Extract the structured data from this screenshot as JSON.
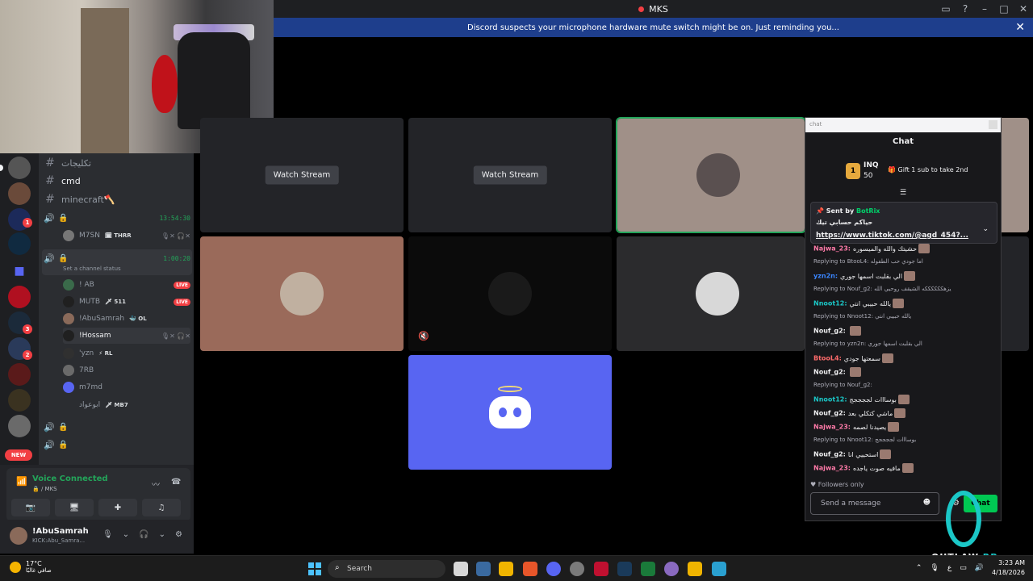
{
  "window": {
    "title": "MKS",
    "notice": "Discord suspects your microphone hardware mute switch might be on. Just reminding you..."
  },
  "rail": {
    "badges": [
      "1",
      "3",
      "2"
    ],
    "new_label": "NEW"
  },
  "channels": {
    "items": [
      {
        "name": "تكليجات"
      },
      {
        "name": "cmd"
      },
      {
        "name": "minecraft🪓"
      }
    ],
    "voice1": {
      "timer": "13:54:30"
    },
    "voice1_members": [
      {
        "name": "M7SN",
        "tag": "🗓 THRR"
      }
    ],
    "voice2": {
      "timer": "1:00:20",
      "status": "Set a channel status"
    },
    "voice2_members": [
      {
        "name": "! AB",
        "tag": "",
        "live": "LIVE"
      },
      {
        "name": "MUTB",
        "tag": "🗡 511",
        "live": "LIVE"
      },
      {
        "name": "!AbuSamrah",
        "tag": "🐳 OL",
        "live": ""
      },
      {
        "name": "!Hossam",
        "tag": "",
        "live": ""
      },
      {
        "name": "'yzn",
        "tag": "⚡ RL",
        "live": ""
      },
      {
        "name": "7RB",
        "tag": "",
        "live": ""
      },
      {
        "name": "m7md",
        "tag": "",
        "live": ""
      },
      {
        "name": "ابوعواد",
        "tag": "🗡 MB7",
        "live": ""
      }
    ]
  },
  "voice_panel": {
    "title": "Voice Connected",
    "subtitle": "🔒 / MKS"
  },
  "user": {
    "name": "!AbuSamrah",
    "status": "KICK:Abu_Samra..."
  },
  "grid": {
    "watch_label": "Watch Stream"
  },
  "chat": {
    "url_placeholder": "chat",
    "title": "Chat",
    "rank": "1",
    "leader": "INQ",
    "leader_count": "50",
    "gift": "Gift 1 sub to take 2nd",
    "pinned": {
      "sent_by": "Sent by",
      "bot": "BotRix",
      "line1": "حياكم حسابي تيك",
      "link": "https://www.tiktok.com/@agd_454?..."
    },
    "messages": [
      {
        "reply": "",
        "user": "Najwa_23:",
        "text": "حشيتك والله والميسوره",
        "color": "#ff7aa8"
      },
      {
        "reply": "Replying to BtooL4: اما جودي حب الطفوله",
        "user": "",
        "text": "",
        "color": "#efeff1"
      },
      {
        "reply": "",
        "user": "yzn2n:",
        "text": "الي بقلبت اسمها جوري",
        "color": "#3a86ff"
      },
      {
        "reply": "Replying to Nouf_g2: يزهككككككه الشيقف روحيي الله",
        "user": "",
        "text": "",
        "color": "#efeff1"
      },
      {
        "reply": "",
        "user": "Nnoot12:",
        "text": "يالله حبيبي انتي",
        "color": "#1bc7c7"
      },
      {
        "reply": "Replying to Nnoot12: يالله حبيبي انتي",
        "user": "",
        "text": "",
        "color": "#efeff1"
      },
      {
        "reply": "",
        "user": "Nouf_g2:",
        "text": "",
        "color": "#efeff1"
      },
      {
        "reply": "Replying to yzn2n: الي بقلبت اسمها جوري",
        "user": "",
        "text": "",
        "color": "#efeff1"
      },
      {
        "reply": "",
        "user": "BtooL4:",
        "text": "سمعتها جودي",
        "color": "#ff6b6b"
      },
      {
        "reply": "",
        "user": "Nouf_g2:",
        "text": "",
        "color": "#efeff1"
      },
      {
        "reply": "Replying to Nouf_g2:",
        "user": "",
        "text": "",
        "color": "#efeff1"
      },
      {
        "reply": "",
        "user": "Nnoot12:",
        "text": "بوسااات لججججج",
        "color": "#1bc7c7"
      },
      {
        "reply": "",
        "user": "Nouf_g2:",
        "text": "ماشي كتكلي بعد",
        "color": "#efeff1"
      },
      {
        "reply": "",
        "user": "Najwa_23:",
        "text": "يصيدنا لصمه",
        "color": "#ff7aa8"
      },
      {
        "reply": "Replying to Nnoot12: بوسااات لججججج",
        "user": "",
        "text": "",
        "color": "#efeff1"
      },
      {
        "reply": "",
        "user": "Nouf_g2:",
        "text": "استحييي انا",
        "color": "#efeff1"
      },
      {
        "reply": "",
        "user": "Najwa_23:",
        "text": "مافيه صوت ياجده",
        "color": "#ff7aa8"
      }
    ],
    "followers": "Followers only",
    "placeholder": "Send a message",
    "send_label": "Chat"
  },
  "watermark": {
    "brand": "OUTLAW",
    "suffix": "RP"
  },
  "taskbar": {
    "temp": "17°C",
    "weather": "صافي غالبًا",
    "search": "Search",
    "lang": "ع",
    "time": "3:23 AM",
    "date": "4/18/2026"
  },
  "colors": {
    "accent": "#5865f2",
    "online": "#23a55a",
    "danger": "#f23f43",
    "notice_bg": "#1e3e8c"
  }
}
